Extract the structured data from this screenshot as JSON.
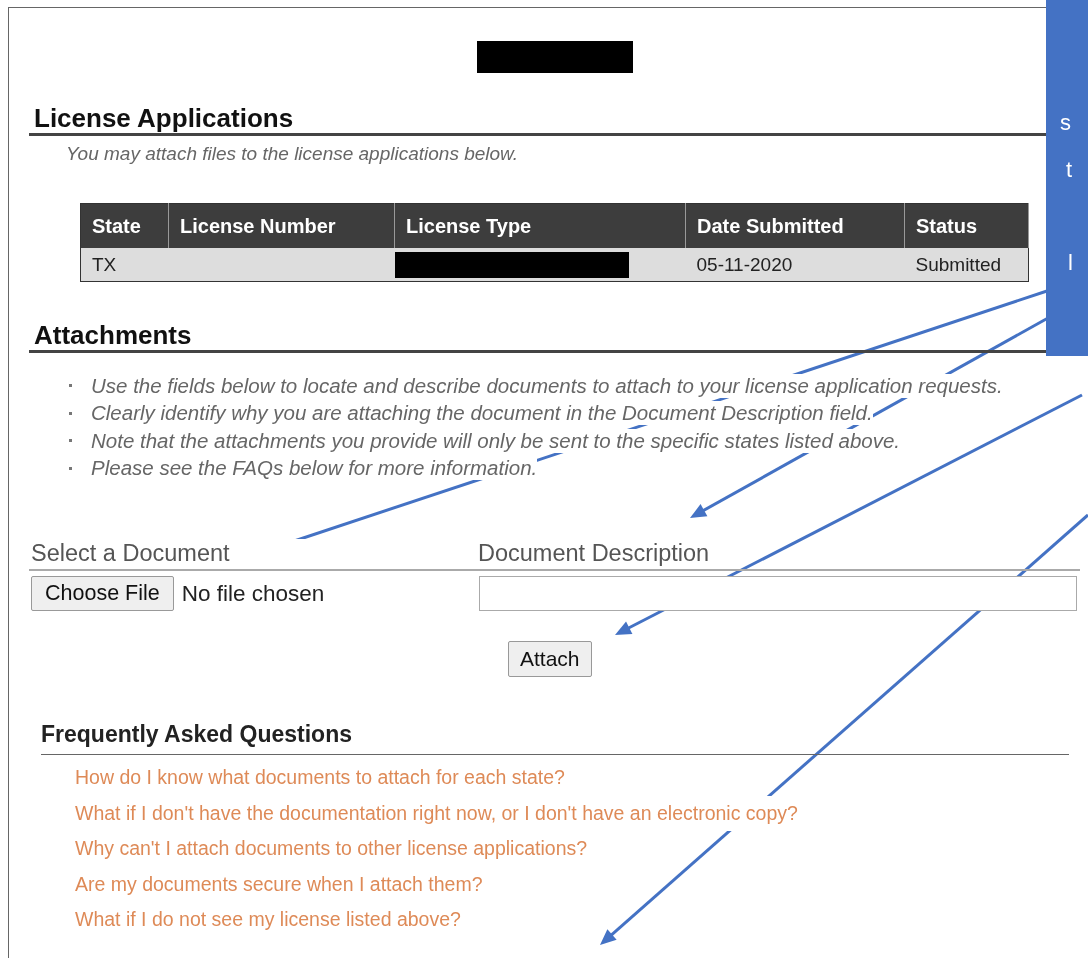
{
  "license_applications": {
    "title": "License Applications",
    "subtitle": "You may attach files to the license applications below.",
    "table": {
      "columns": [
        "State",
        "License Number",
        "License Type",
        "Date Submitted",
        "Status"
      ],
      "rows": [
        {
          "state": "TX",
          "date_submitted": "05-11-2020",
          "status": "Submitted"
        }
      ]
    }
  },
  "attachments": {
    "title": "Attachments",
    "instructions": [
      "Use the fields below to locate and describe documents to attach to your license application requests.",
      "Clearly identify why you are attaching the document in the Document Description field.",
      "Note that the attachments you provide will only be sent to the specific states listed above.",
      "Please see the FAQs below for more information."
    ],
    "select_label": "Select a Document",
    "description_label": "Document Description",
    "choose_button": "Choose File",
    "file_status": "No file chosen",
    "attach_button": "Attach"
  },
  "faq": {
    "title": "Frequently Asked Questions",
    "questions": [
      "How do I know what documents to attach for each state?",
      "What if I don't have the documentation right now, or I don't have an electronic copy?",
      "Why can't I attach documents to other license applications?",
      "Are my documents secure when I attach them?",
      "What if I do not see my license listed above?"
    ]
  },
  "callout": {
    "fragments": [
      "s",
      "t",
      "l"
    ]
  }
}
